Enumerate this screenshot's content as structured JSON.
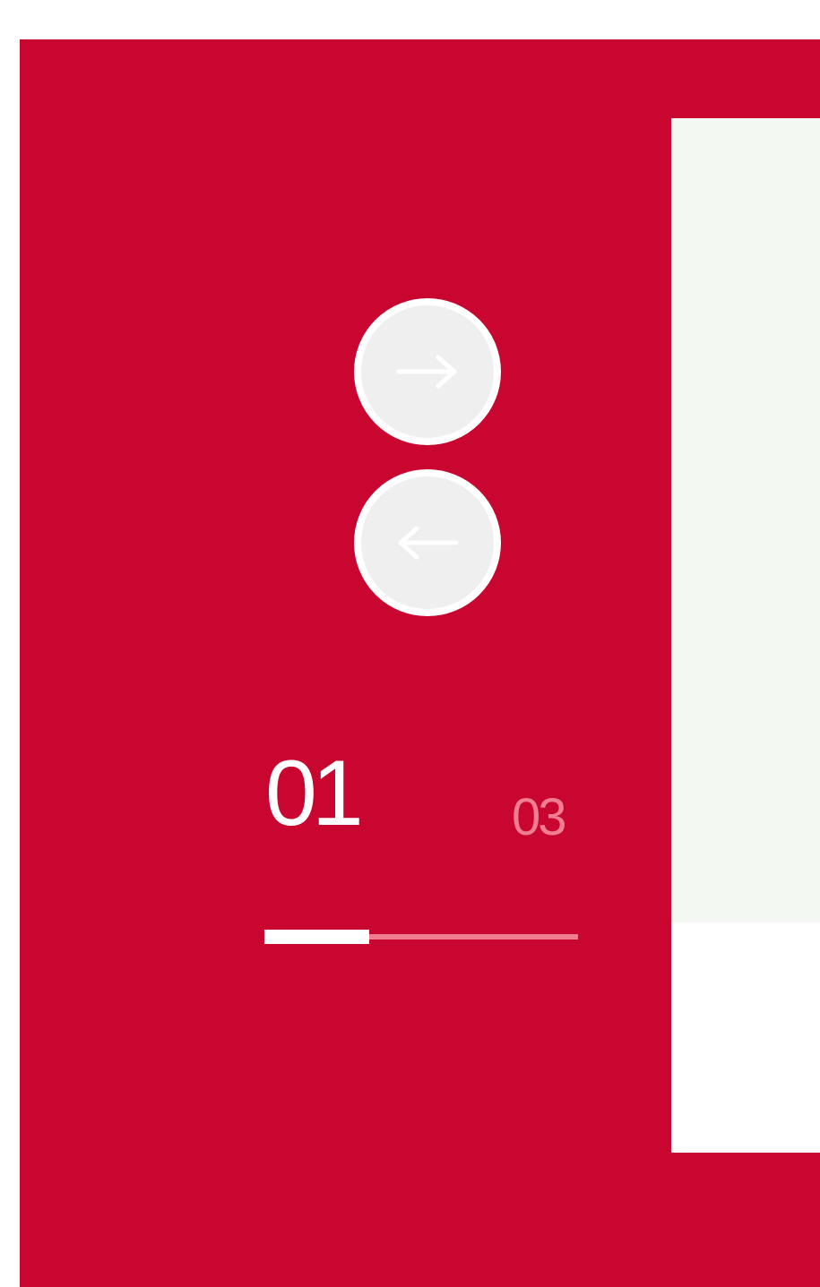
{
  "colors": {
    "panel": "#c8062f",
    "accent_white": "#ffffff",
    "muted_pink": "#f07d92",
    "slide_background": "#f4f8f3"
  },
  "navigation": {
    "next_icon": "arrow-right-icon",
    "previous_icon": "arrow-left-icon"
  },
  "slider": {
    "current": "01",
    "total": "03",
    "progress_fraction": 0.333
  }
}
